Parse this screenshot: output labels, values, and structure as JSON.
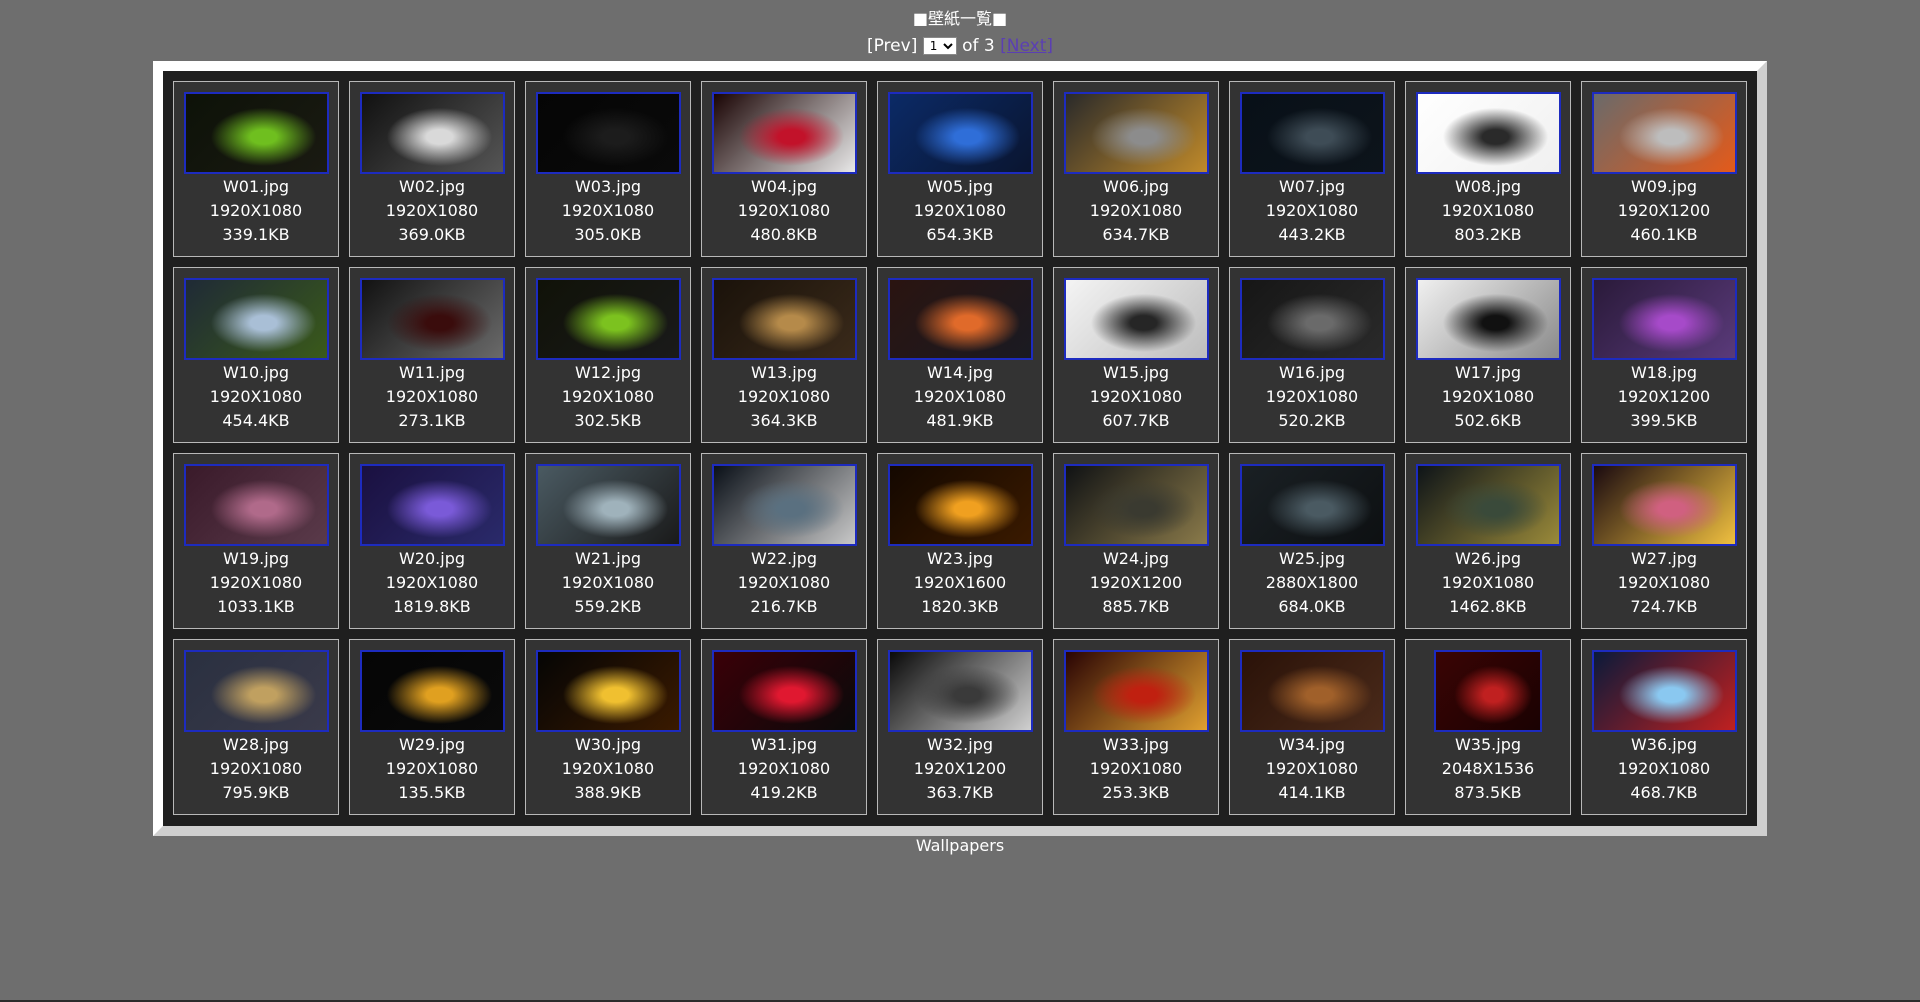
{
  "header": {
    "title": "■壁紙一覧■"
  },
  "pager": {
    "prev_label": "[Prev]",
    "page_select_value": "1",
    "of_label": "of 3",
    "next_label": "[Next]"
  },
  "footer": {
    "caption": "Wallpapers"
  },
  "colors": {
    "page_background": "#6e6e6e",
    "frame_background": "#1f1f1f",
    "tile_background": "#333333",
    "thumbnail_border": "#1d2bbf",
    "next_link": "#5b3fb3"
  },
  "wallpapers": [
    {
      "name": "W01.jpg",
      "resolution": "1920X1080",
      "size": "339.1KB",
      "thumb": [
        "#0d1208",
        "#6fbf1f",
        "#1a1a12"
      ]
    },
    {
      "name": "W02.jpg",
      "resolution": "1920X1080",
      "size": "369.0KB",
      "thumb": [
        "#111111",
        "#d9d9d9",
        "#555555"
      ]
    },
    {
      "name": "W03.jpg",
      "resolution": "1920X1080",
      "size": "305.0KB",
      "thumb": [
        "#050505",
        "#1c1c1c",
        "#0a0a0a"
      ]
    },
    {
      "name": "W04.jpg",
      "resolution": "1920X1080",
      "size": "480.8KB",
      "thumb": [
        "#1a0404",
        "#c2122a",
        "#e8e8e8"
      ]
    },
    {
      "name": "W05.jpg",
      "resolution": "1920X1080",
      "size": "654.3KB",
      "thumb": [
        "#0b2a66",
        "#2f6ed8",
        "#0a1530"
      ]
    },
    {
      "name": "W06.jpg",
      "resolution": "1920X1080",
      "size": "634.7KB",
      "thumb": [
        "#2a2a2a",
        "#8c8c8c",
        "#c08a2a"
      ]
    },
    {
      "name": "W07.jpg",
      "resolution": "1920X1080",
      "size": "443.2KB",
      "thumb": [
        "#081018",
        "#3e4c56",
        "#0d141b"
      ]
    },
    {
      "name": "W08.jpg",
      "resolution": "1920X1080",
      "size": "803.2KB",
      "thumb": [
        "#ffffff",
        "#2a2a2a",
        "#f0f0f0"
      ]
    },
    {
      "name": "W09.jpg",
      "resolution": "1920X1200",
      "size": "460.1KB",
      "thumb": [
        "#6a6a6a",
        "#bdbdbd",
        "#e45a1a"
      ]
    },
    {
      "name": "W10.jpg",
      "resolution": "1920X1080",
      "size": "454.4KB",
      "thumb": [
        "#1f2a36",
        "#a9bfd6",
        "#3a5a1a"
      ]
    },
    {
      "name": "W11.jpg",
      "resolution": "1920X1080",
      "size": "273.1KB",
      "thumb": [
        "#121212",
        "#3a0c0c",
        "#6a6a6a"
      ]
    },
    {
      "name": "W12.jpg",
      "resolution": "1920X1080",
      "size": "302.5KB",
      "thumb": [
        "#101208",
        "#7cc21f",
        "#1a1a1a"
      ]
    },
    {
      "name": "W13.jpg",
      "resolution": "1920X1080",
      "size": "364.3KB",
      "thumb": [
        "#1a120a",
        "#b58a4a",
        "#3a2a1a"
      ]
    },
    {
      "name": "W14.jpg",
      "resolution": "1920X1080",
      "size": "481.9KB",
      "thumb": [
        "#2a1410",
        "#e06a2a",
        "#1a1a22"
      ]
    },
    {
      "name": "W15.jpg",
      "resolution": "1920X1080",
      "size": "607.7KB",
      "thumb": [
        "#f4f4f4",
        "#262626",
        "#bdbdbd"
      ]
    },
    {
      "name": "W16.jpg",
      "resolution": "1920X1080",
      "size": "520.2KB",
      "thumb": [
        "#161616",
        "#6a6a6a",
        "#2a2a2a"
      ]
    },
    {
      "name": "W17.jpg",
      "resolution": "1920X1080",
      "size": "502.6KB",
      "thumb": [
        "#f0f0f0",
        "#111111",
        "#8a8a8a"
      ]
    },
    {
      "name": "W18.jpg",
      "resolution": "1920X1200",
      "size": "399.5KB",
      "thumb": [
        "#2a1a3a",
        "#a64ac9",
        "#5a3a7a"
      ]
    },
    {
      "name": "W19.jpg",
      "resolution": "1920X1080",
      "size": "1033.1KB",
      "thumb": [
        "#3a1a2a",
        "#b06a8a",
        "#5a3a4a"
      ]
    },
    {
      "name": "W20.jpg",
      "resolution": "1920X1080",
      "size": "1819.8KB",
      "thumb": [
        "#1a1040",
        "#7a5ad8",
        "#2a2a6a"
      ]
    },
    {
      "name": "W21.jpg",
      "resolution": "1920X1080",
      "size": "559.2KB",
      "thumb": [
        "#4a5a62",
        "#9fb2bb",
        "#1a1a1a"
      ]
    },
    {
      "name": "W22.jpg",
      "resolution": "1920X1080",
      "size": "216.7KB",
      "thumb": [
        "#0a1018",
        "#5a7080",
        "#c8c8c8"
      ]
    },
    {
      "name": "W23.jpg",
      "resolution": "1920X1600",
      "size": "1820.3KB",
      "thumb": [
        "#140800",
        "#f0a020",
        "#3a1a00"
      ]
    },
    {
      "name": "W24.jpg",
      "resolution": "1920X1200",
      "size": "885.7KB",
      "thumb": [
        "#101214",
        "#3a3a30",
        "#8a7a4a"
      ]
    },
    {
      "name": "W25.jpg",
      "resolution": "2880X1800",
      "size": "684.0KB",
      "thumb": [
        "#1a2024",
        "#4a5a62",
        "#0d1012"
      ]
    },
    {
      "name": "W26.jpg",
      "resolution": "1920X1080",
      "size": "1462.8KB",
      "thumb": [
        "#0e1418",
        "#3a4a3a",
        "#9a8a3a"
      ]
    },
    {
      "name": "W27.jpg",
      "resolution": "1920X1080",
      "size": "724.7KB",
      "thumb": [
        "#1a0a10",
        "#d06080",
        "#f0c040"
      ]
    },
    {
      "name": "W28.jpg",
      "resolution": "1920X1080",
      "size": "795.9KB",
      "thumb": [
        "#2a3040",
        "#c0a060",
        "#3a3a4a"
      ]
    },
    {
      "name": "W29.jpg",
      "resolution": "1920X1080",
      "size": "135.5KB",
      "thumb": [
        "#050505",
        "#e0a020",
        "#0a0a0a"
      ]
    },
    {
      "name": "W30.jpg",
      "resolution": "1920X1080",
      "size": "388.9KB",
      "thumb": [
        "#050505",
        "#f0c030",
        "#3a1a00"
      ]
    },
    {
      "name": "W31.jpg",
      "resolution": "1920X1080",
      "size": "419.2KB",
      "thumb": [
        "#3a0008",
        "#e01830",
        "#0a0a0a"
      ]
    },
    {
      "name": "W32.jpg",
      "resolution": "1920X1200",
      "size": "363.7KB",
      "thumb": [
        "#0a0a0a",
        "#3a3a3a",
        "#d0d0d0"
      ]
    },
    {
      "name": "W33.jpg",
      "resolution": "1920X1080",
      "size": "253.3KB",
      "thumb": [
        "#2a0404",
        "#c02010",
        "#e0a030"
      ]
    },
    {
      "name": "W34.jpg",
      "resolution": "1920X1080",
      "size": "414.1KB",
      "thumb": [
        "#2a1208",
        "#a0602a",
        "#4a2a1a"
      ]
    },
    {
      "name": "W35.jpg",
      "resolution": "2048X1536",
      "size": "873.5KB",
      "thumb": [
        "#3a0404",
        "#c02020",
        "#1a0202"
      ]
    },
    {
      "name": "W36.jpg",
      "resolution": "1920X1080",
      "size": "468.7KB",
      "thumb": [
        "#0a1a3a",
        "#8ac8f0",
        "#c02020"
      ]
    }
  ]
}
